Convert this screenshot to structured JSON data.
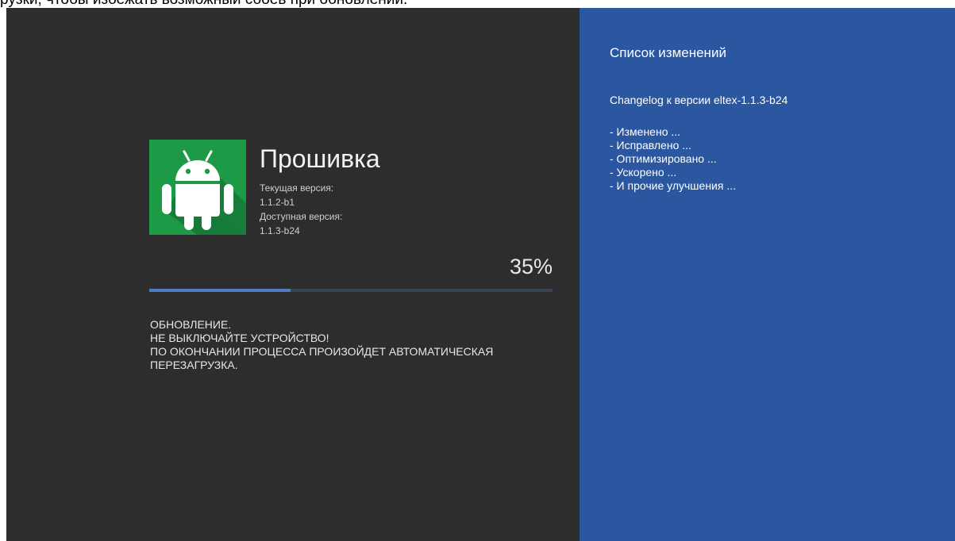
{
  "top_caption": "рузки, чтобы избежать возможный сбоев при обновлении.",
  "firmware": {
    "title": "Прошивка",
    "current_version_label": "Текущая версия:",
    "current_version": "1.1.2-b1",
    "available_version_label": "Доступная версия:",
    "available_version": "1.1.3-b24"
  },
  "progress": {
    "percent_label": "35%",
    "fraction": 0.35
  },
  "warning_lines": [
    "ОБНОВЛЕНИЕ.",
    "НЕ ВЫКЛЮЧАЙТЕ УСТРОЙСТВО!",
    "ПО ОКОНЧАНИИ ПРОЦЕССА ПРОИЗОЙДЕТ АВТОМАТИЧЕСКАЯ",
    "ПЕРЕЗАГРУЗКА."
  ],
  "changelog": {
    "title": "Список изменений",
    "version_line": "Changelog к версии eltex-1.1.3-b24",
    "items": [
      "- Изменено ...",
      "- Исправлено ...",
      "- Оптимизировано  ...",
      "- Ускорено  ...",
      "- И прочие улучшения ..."
    ]
  },
  "colors": {
    "left_bg": "#2d2d2d",
    "right_bg": "#2a57a0",
    "logo_bg": "#1c9a46",
    "progress_fill": "#4f7cc2"
  },
  "icons": {
    "logo": "android-robot-icon"
  }
}
